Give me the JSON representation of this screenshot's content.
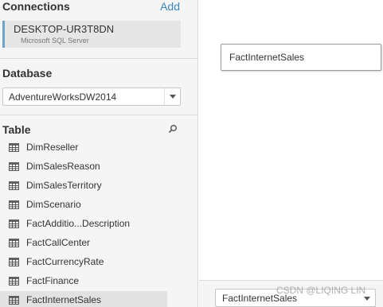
{
  "connections": {
    "title": "Connections",
    "add_label": "Add",
    "items": [
      {
        "name": "DESKTOP-UR3T8DN",
        "type": "Microsoft SQL Server"
      }
    ]
  },
  "database": {
    "title": "Database",
    "selected": "AdventureWorksDW2014"
  },
  "tables": {
    "title": "Table",
    "items": [
      {
        "label": "DimReseller"
      },
      {
        "label": "DimSalesReason"
      },
      {
        "label": "DimSalesTerritory"
      },
      {
        "label": "DimScenario"
      },
      {
        "label": "FactAdditio...Description"
      },
      {
        "label": "FactCallCenter"
      },
      {
        "label": "FactCurrencyRate"
      },
      {
        "label": "FactFinance"
      },
      {
        "label": "FactInternetSales"
      }
    ]
  },
  "canvas": {
    "table_label": "FactInternetSales"
  },
  "bottom": {
    "selected_table": "FactInternetSales"
  },
  "watermark": "CSDN @LIQING LIN",
  "colors": {
    "accent": "#3a88c6",
    "connection_bar": "#6ea3c8",
    "sidebar_bg": "#f5f5f5"
  }
}
